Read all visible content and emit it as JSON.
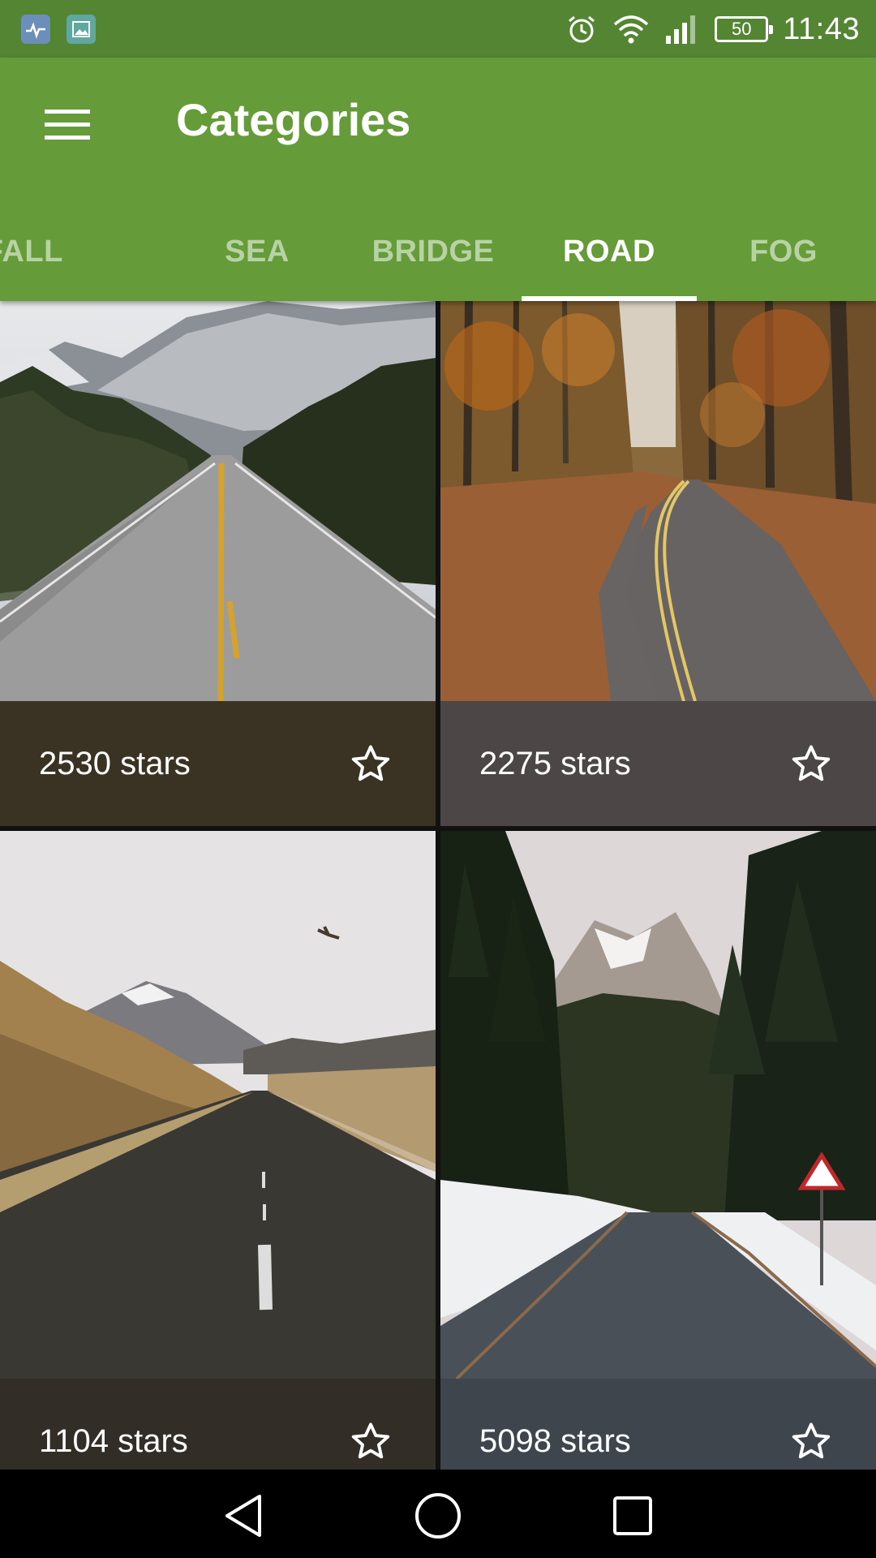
{
  "status_bar": {
    "notification_icons": [
      "health-icon",
      "gallery-icon"
    ],
    "icons": [
      "alarm-icon",
      "wifi-icon",
      "signal-icon"
    ],
    "battery_level": "50",
    "time": "11:43"
  },
  "app_bar": {
    "menu_icon": "menu-icon",
    "title": "Categories"
  },
  "tabs": [
    {
      "label": "ATERFALL",
      "active": false
    },
    {
      "label": "SEA",
      "active": false
    },
    {
      "label": "BRIDGE",
      "active": false
    },
    {
      "label": "ROAD",
      "active": true
    },
    {
      "label": "FOG",
      "active": false
    }
  ],
  "cards": [
    {
      "stars": "2530 stars",
      "icon": "star-outline-icon",
      "footer_color": "#3a3222"
    },
    {
      "stars": "2275 stars",
      "icon": "star-outline-icon",
      "footer_color": "#4c4647"
    },
    {
      "stars": "1104 stars",
      "icon": "star-outline-icon",
      "footer_color": "#322e27"
    },
    {
      "stars": "5098 stars",
      "icon": "star-outline-icon",
      "footer_color": "#3e454c"
    }
  ],
  "nav_bar": {
    "icons": [
      "back-icon",
      "home-icon",
      "recents-icon"
    ]
  }
}
